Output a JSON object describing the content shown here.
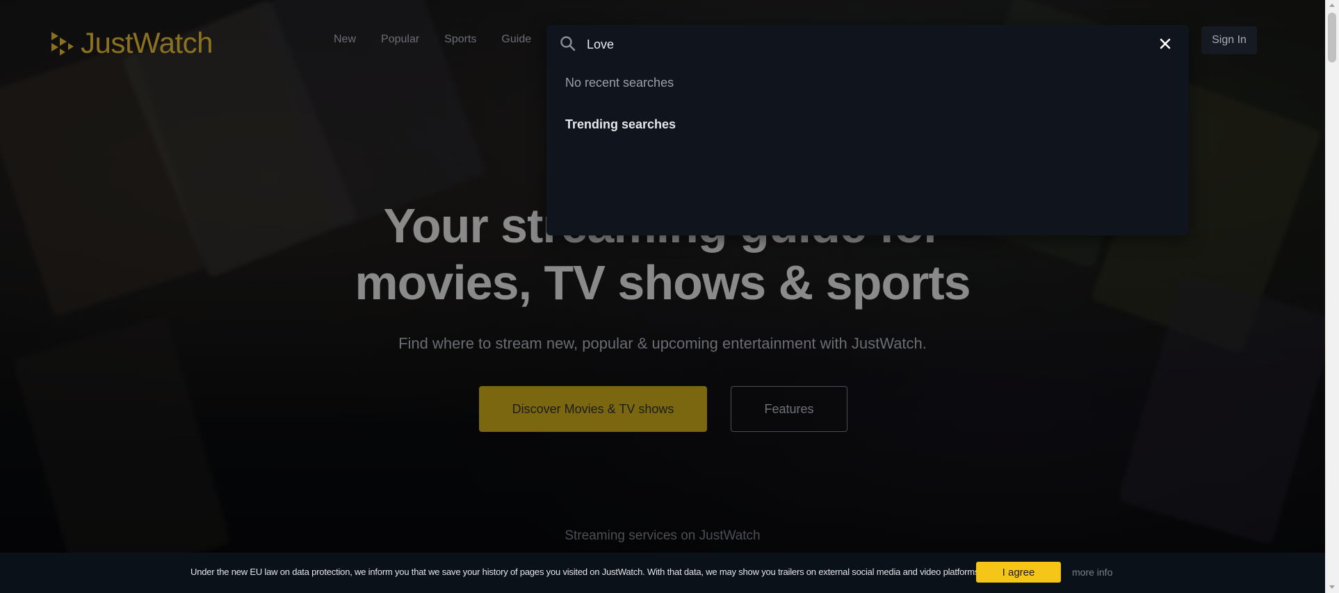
{
  "logo": {
    "text": "JustWatch"
  },
  "nav": {
    "items": [
      "New",
      "Popular",
      "Sports",
      "Guide"
    ]
  },
  "header": {
    "signin_label": "Sign In"
  },
  "search": {
    "value": "Love",
    "placeholder": "",
    "no_recent": "No recent searches",
    "trending_title": "Trending searches"
  },
  "hero": {
    "title_line1": "Your streaming guide for",
    "title_line2": "movies, TV shows & sports",
    "subtitle": "Find where to stream new, popular & upcoming entertainment with JustWatch.",
    "discover_label": "Discover Movies & TV shows",
    "features_label": "Features",
    "streaming_label": "Streaming services on JustWatch"
  },
  "cookie": {
    "text": "Under the new EU law on data protection, we inform you that we save your history of pages you visited on JustWatch. With that data, we may show you trailers on external social media and video platforms.",
    "agree_label": "I agree",
    "more_label": "more info"
  },
  "colors": {
    "accent": "#f5c518",
    "panel": "#10151d",
    "cookie_bg": "#0b1119"
  },
  "icons": {
    "logo": "play-triangle-logo-icon",
    "search": "search-icon",
    "close": "close-icon"
  }
}
